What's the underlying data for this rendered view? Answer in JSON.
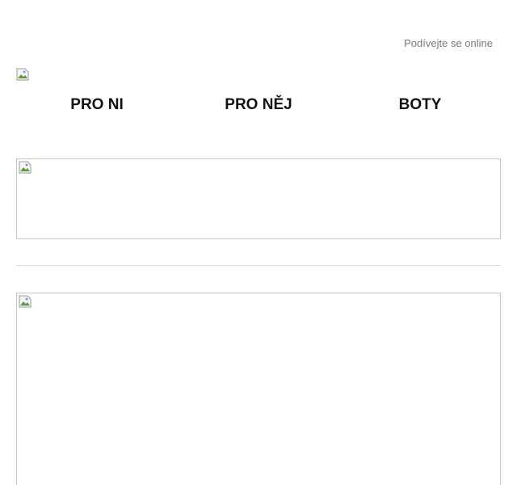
{
  "header": {
    "view_online_label": "Podívejte se online"
  },
  "logo": {
    "icon": "broken-image-icon"
  },
  "nav": {
    "items": [
      {
        "label": "PRO NI"
      },
      {
        "label": "PRO NĚJ"
      },
      {
        "label": "BOTY"
      }
    ]
  },
  "banners": {
    "top_icon": "broken-image-icon",
    "main_icon": "broken-image-icon"
  },
  "colors": {
    "nav_text": "#111111",
    "muted_text": "#7a7a7a",
    "border": "#c6c6c6",
    "divider": "#dddddd"
  }
}
